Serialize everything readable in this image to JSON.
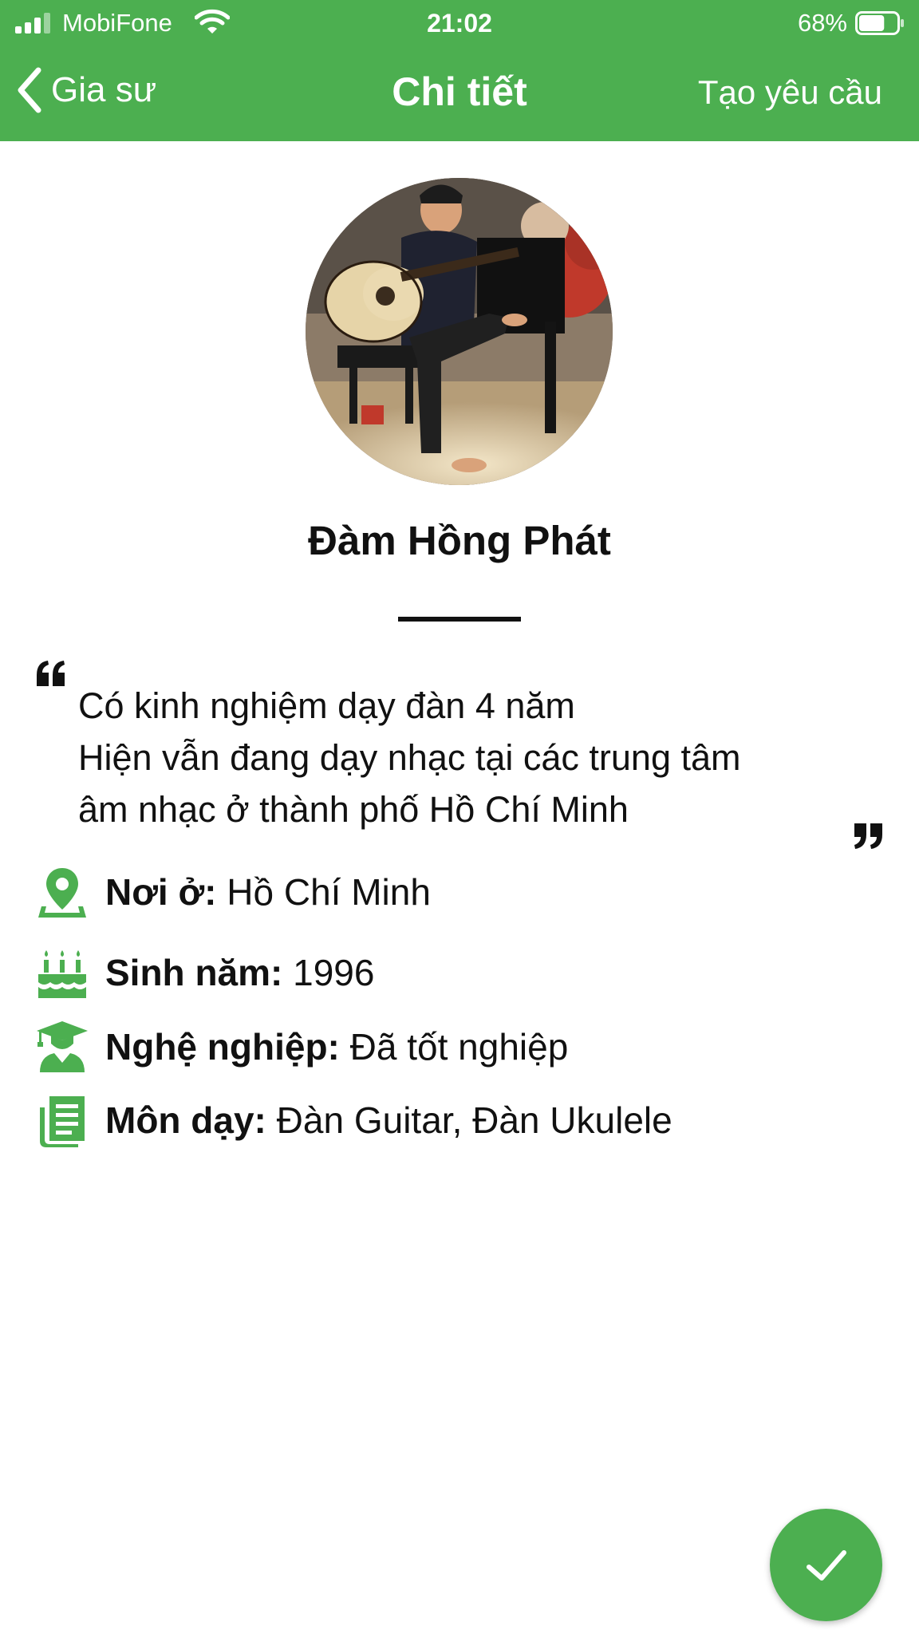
{
  "theme": {
    "primary_color": "#4caf50",
    "header_text_color": "#ffffff",
    "text_color": "#111111"
  },
  "status_bar": {
    "carrier": "MobiFone",
    "time": "21:02",
    "battery_percent": "68%",
    "battery_level": 0.68,
    "icons": [
      "signal-icon",
      "wifi-icon",
      "battery-icon"
    ]
  },
  "nav": {
    "back_label": "Gia sư",
    "title": "Chi tiết",
    "action_label": "Tạo yêu cầu"
  },
  "profile": {
    "name": "Đàm Hồng Phát",
    "quote_lines": [
      "Có kinh nghiệm dạy đàn 4 năm",
      "Hiện vẫn đang dạy nhạc tại các trung tâm",
      "âm nhạc ở thành phố Hồ Chí Minh"
    ]
  },
  "info": [
    {
      "icon": "location-pin-icon",
      "label": "Nơi ở:",
      "value": " Hồ Chí Minh"
    },
    {
      "icon": "birthday-cake-icon",
      "label": "Sinh năm:",
      "value": " 1996"
    },
    {
      "icon": "graduate-icon",
      "label": "Nghệ nghiệp:",
      "value": " Đã tốt nghiệp"
    },
    {
      "icon": "subjects-book-icon",
      "label": "Môn dạy:",
      "value": " Đàn Guitar, Đàn Ukulele"
    }
  ],
  "fab": {
    "icon": "checkmark-icon"
  }
}
